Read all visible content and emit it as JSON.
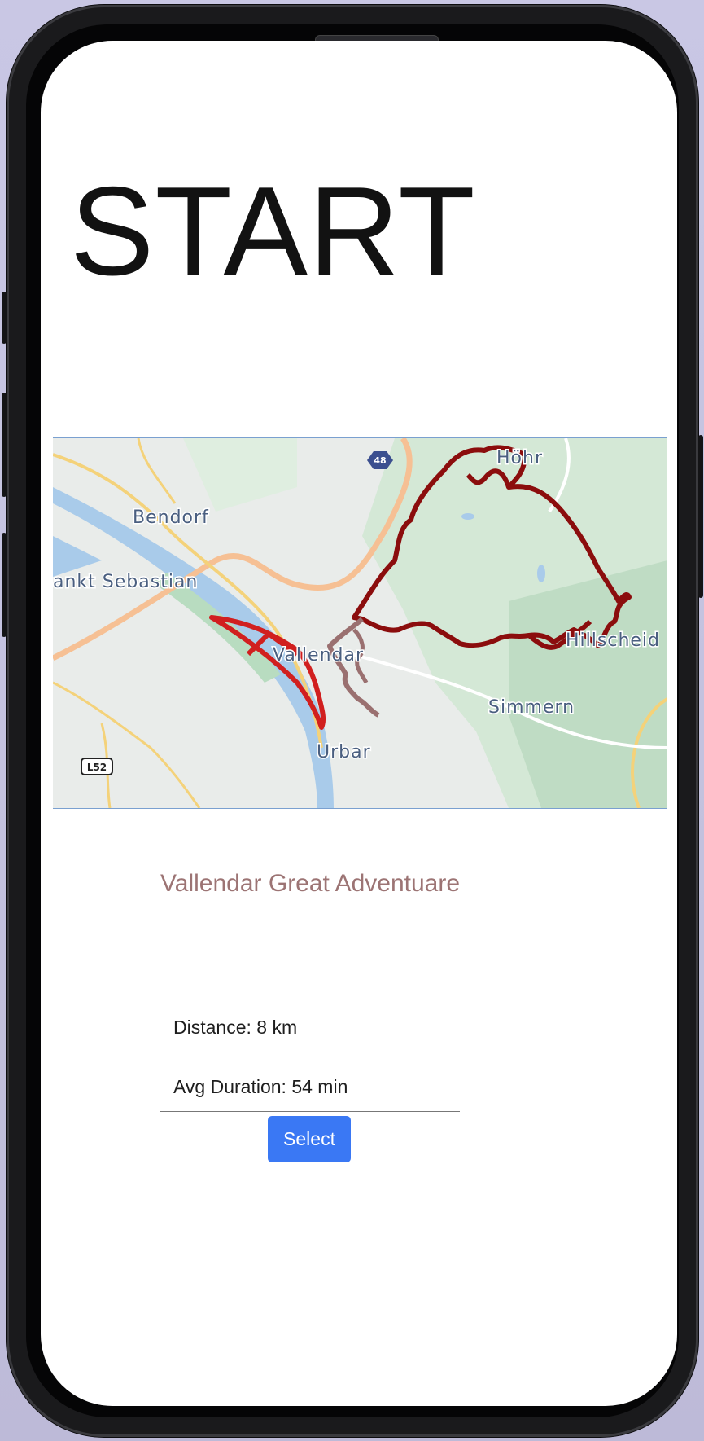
{
  "screen": {
    "hero_title": "START"
  },
  "map": {
    "place_labels": [
      "Höhr",
      "Bendorf",
      "ankt Sebastian",
      "Vallendar",
      "Hillscheid",
      "Simmern",
      "Urbar"
    ],
    "road_shields": [
      "48",
      "L52"
    ],
    "colors": {
      "water": "#a9cbea",
      "land": "#e9ecea",
      "forest": "#cfe4d2",
      "highway": "#f6c094",
      "road": "#f4d27a",
      "route_main": "#8b0d0d",
      "route_red": "#d11f1f",
      "route_brown": "#9a7070"
    }
  },
  "route": {
    "title": "Vallendar Great Adventuare",
    "distance": "Distance: 8 km",
    "duration": "Avg Duration: 54 min",
    "select_label": "Select"
  }
}
